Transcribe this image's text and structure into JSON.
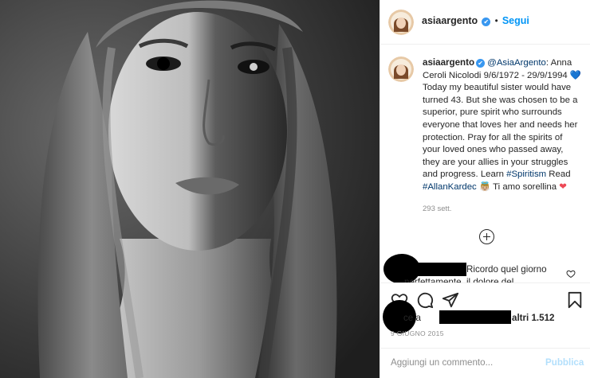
{
  "header": {
    "username": "asiaargento",
    "verified_glyph": "✔",
    "follow_label": "Segui"
  },
  "caption": {
    "username": "asiaargento",
    "mention": "@AsiaArgento",
    "text_1": ": Anna Ceroli Nicolodi 9/6/1972 - 29/9/1994",
    "emoji_blue_heart": "💙",
    "text_2": " Today my beautiful sister would have turned 43. But she was chosen to be a superior, pure spirit who surrounds everyone that loves her and needs her protection. Pray for all the spirits of your loved ones who passed away, they are your allies in your struggles and progress. Learn ",
    "tag_1": "#Spiritism",
    "text_3": " Read ",
    "tag_2": "#AllanKardec",
    "emoji_angel": "👼🏼",
    "text_4": " Ti amo sorellina ",
    "emoji_red_heart": "❤",
    "timestamp": "293 sett."
  },
  "comment": {
    "text_line_1": "Ricordo quel giorno",
    "text_line_2": "perfettamente, il dolore del"
  },
  "likes": {
    "text_left": "ce a",
    "text_right": "altri 1.512"
  },
  "date": "9 GIUGNO 2015",
  "add_comment": {
    "placeholder": "Aggiungi un commento...",
    "publish_label": "Pubblica"
  },
  "icons": {
    "heart": "heart-icon",
    "comment": "comment-icon",
    "share": "share-icon",
    "save": "bookmark-icon",
    "add": "plus-circle-icon"
  }
}
